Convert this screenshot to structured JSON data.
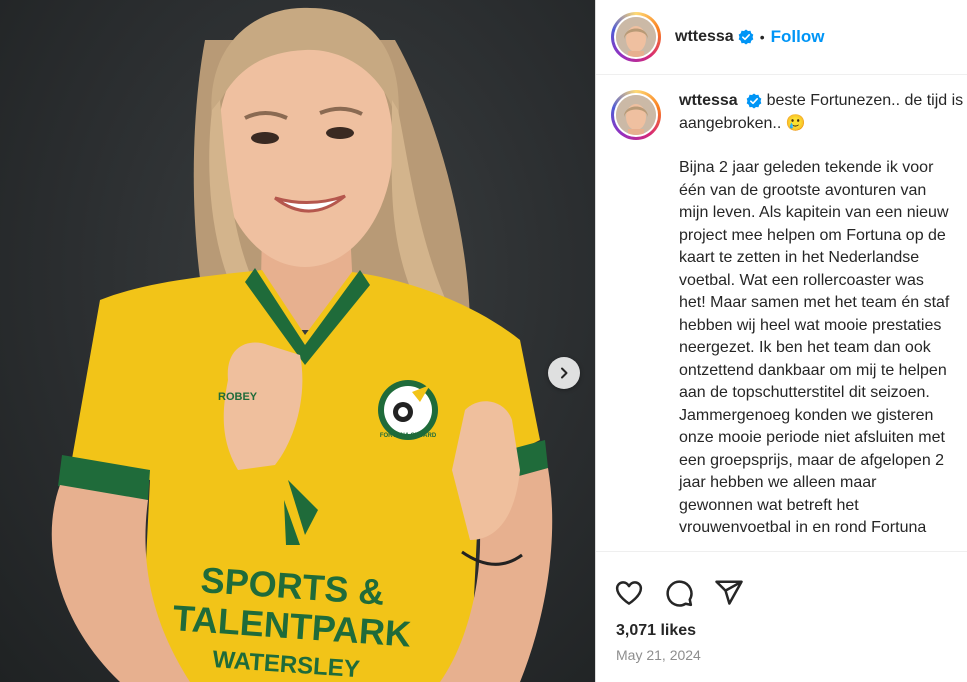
{
  "post": {
    "username": "wttessa",
    "follow_label": "Follow",
    "separator": "•",
    "caption_lines_first": [
      "beste Fortunezen.. de tijd is",
      "aangebroken.. 🥲"
    ],
    "caption_lines_body": [
      "Bijna 2 jaar geleden tekende ik voor",
      "één van de grootste avonturen van",
      "mijn leven. Als kapitein van een nieuw",
      "project mee helpen om Fortuna op de",
      "kaart te zetten in het Nederlandse",
      "voetbal. Wat een rollercoaster was",
      "het! Maar samen met het team én staf",
      "hebben wij heel wat mooie prestaties",
      "neergezet. Ik ben het team dan ook",
      "ontzettend dankbaar om mij te helpen",
      "aan de topschutterstitel dit seizoen.",
      "Jammergenoeg konden we gisteren",
      "onze mooie periode niet afsluiten met",
      "een groepsprijs, maar de afgelopen 2",
      "jaar hebben we alleen maar",
      "gewonnen wat betreft het",
      "vrouwenvoetbal in en rond Fortuna"
    ],
    "likes": "3,071 likes",
    "date": "May 21, 2024"
  },
  "photo": {
    "shirt_text_line1": "SPORTS &",
    "shirt_text_line2": "TALENTPARK",
    "shirt_text_line3": "WATERSLEY",
    "crest_text": "FORTUNA SITTARD",
    "sleeve_text": "ROBEY"
  },
  "icons": {
    "carousel": "chevron-right-icon",
    "like": "heart-icon",
    "comment": "comment-icon",
    "share": "share-icon",
    "verified": "verified-badge-icon"
  },
  "colors": {
    "accent": "#0095f6",
    "shirt_yellow": "#f2c418",
    "shirt_green": "#1f6b3a",
    "background": "#2e3133"
  }
}
